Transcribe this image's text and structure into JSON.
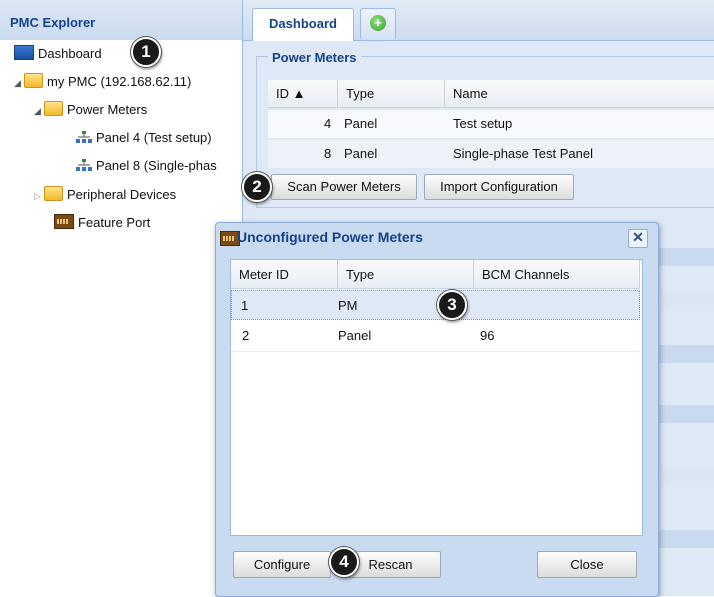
{
  "sidebar": {
    "title": "PMC Explorer",
    "items": [
      {
        "label": "Dashboard",
        "icon": "dashboard-icon"
      },
      {
        "label": "my PMC (192.168.62.11)",
        "icon": "folder-icon"
      },
      {
        "label": "Power Meters",
        "icon": "folder-icon"
      },
      {
        "label": "Panel 4 (Test setup)",
        "icon": "network-icon"
      },
      {
        "label": "Panel 8 (Single-phas",
        "icon": "network-icon"
      },
      {
        "label": "Peripheral Devices",
        "icon": "folder-icon"
      },
      {
        "label": "Feature Port",
        "icon": "port-icon"
      }
    ]
  },
  "tabs": {
    "dashboard": "Dashboard",
    "add_icon": "plus-icon"
  },
  "power_meters": {
    "legend": "Power Meters",
    "columns": [
      "ID ▲",
      "Type",
      "Name"
    ],
    "rows": [
      {
        "id": "4",
        "type": "Panel",
        "name": "Test setup"
      },
      {
        "id": "8",
        "type": "Panel",
        "name": "Single-phase Test Panel"
      }
    ],
    "scan_button": "Scan Power Meters",
    "import_button": "Import Configuration"
  },
  "dialog": {
    "title": "Unconfigured Power Meters",
    "columns": [
      "Meter ID",
      "Type",
      "BCM Channels"
    ],
    "rows": [
      {
        "meter_id": "1",
        "type": "PM",
        "bcm": ""
      },
      {
        "meter_id": "2",
        "type": "Panel",
        "bcm": "96"
      }
    ],
    "configure_button": "Configure",
    "rescan_button": "Rescan",
    "close_button": "Close",
    "close_icon": "✕"
  },
  "callouts": [
    "1",
    "2",
    "3",
    "4"
  ],
  "colors": {
    "panel_bg": "#dfe8f6",
    "header_text": "#15428b",
    "border": "#99bbe8"
  }
}
